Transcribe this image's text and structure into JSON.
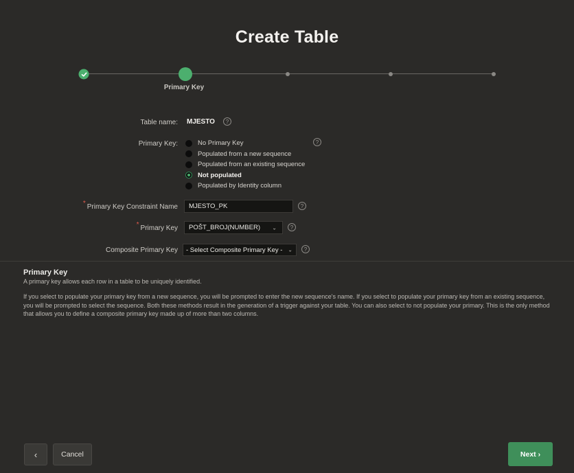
{
  "dialog": {
    "title": "Create Table"
  },
  "wizard": {
    "current_step_label": "Primary Key"
  },
  "form": {
    "table_name": {
      "label": "Table name:",
      "value": "MJESTO",
      "help_icon": "question-circle-icon"
    },
    "primary_key_options": {
      "label": "Primary Key:",
      "options": [
        "No Primary Key",
        "Populated from a new sequence",
        "Populated from an existing sequence",
        "Not populated",
        "Populated by Identity column"
      ],
      "selected": "Not populated"
    },
    "constraint_name": {
      "label": "Primary Key Constraint Name",
      "value": "MJESTO_PK"
    },
    "primary_key": {
      "label": "Primary Key",
      "value": "POŠT_BROJ(NUMBER)"
    },
    "composite_key": {
      "label": "Composite Primary Key",
      "value": "- Select Composite Primary Key -"
    }
  },
  "help": {
    "title": "Primary Key",
    "subtitle": "A primary key allows each row in a table to be uniquely identified.",
    "body": "If you select to populate your primary key from a new sequence, you will be prompted to enter the new sequence's name. If you select to populate your primary key from an existing sequence, you will be prompted to select the sequence. Both these methods result in the generation of a trigger against your table. You can also select to not populate your primary. This is the only method that allows you to define a composite primary key made up of more than two columns."
  },
  "footer": {
    "back_label": "‹",
    "cancel_label": "Cancel",
    "next_label": "Next ›"
  },
  "colors": {
    "accent": "#4caf6e",
    "background": "#2b2a28",
    "required": "#e0594c"
  }
}
